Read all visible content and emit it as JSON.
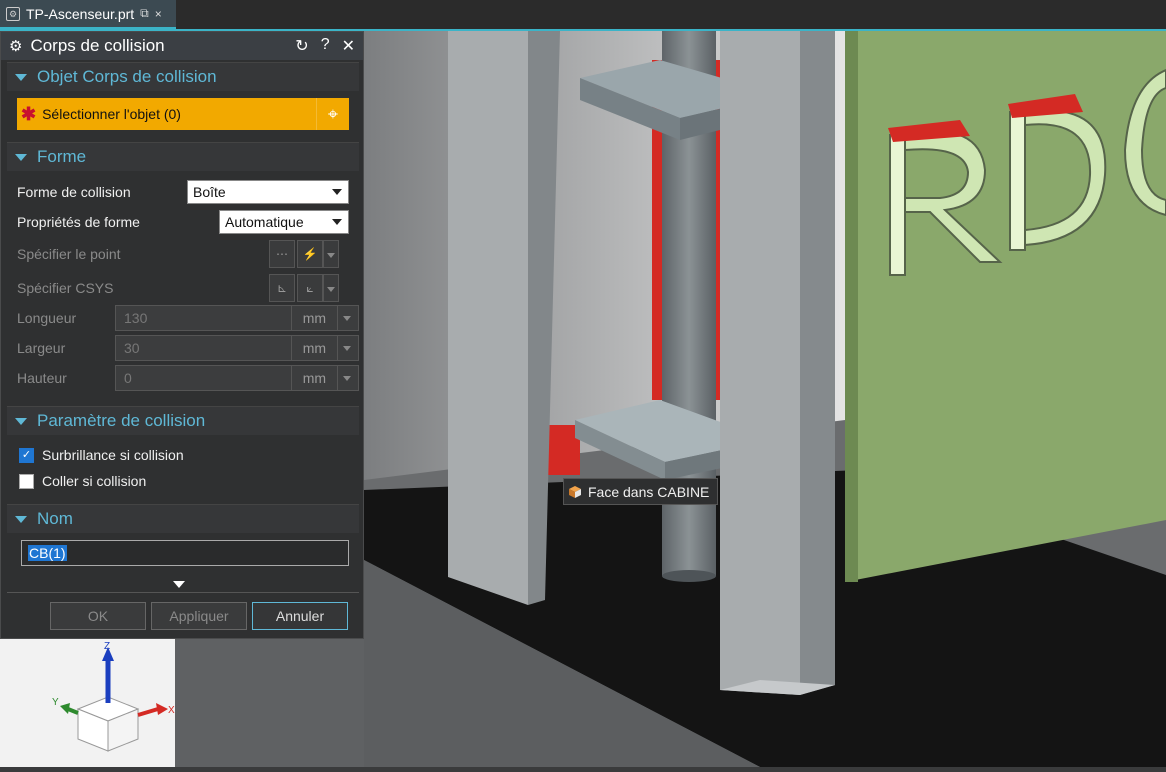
{
  "tab": {
    "title": "TP-Ascenseur.prt",
    "close": "×"
  },
  "dialog": {
    "title": "Corps de collision",
    "tools": {
      "reset": "↻",
      "help": "?",
      "close": "✕"
    },
    "sections": {
      "object": {
        "title": "Objet Corps de collision",
        "select_label": "Sélectionner l'objet (0)"
      },
      "shape": {
        "title": "Forme",
        "collision_shape_label": "Forme de collision",
        "collision_shape_value": "Boîte",
        "shape_props_label": "Propriétés de forme",
        "shape_props_value": "Automatique",
        "specify_point_label": "Spécifier le point",
        "specify_csys_label": "Spécifier CSYS",
        "length_label": "Longueur",
        "length_value": "130",
        "width_label": "Largeur",
        "width_value": "30",
        "height_label": "Hauteur",
        "height_value": "0",
        "unit": "mm"
      },
      "collision": {
        "title": "Paramètre de collision",
        "highlight_label": "Surbrillance si collision",
        "highlight_checked": true,
        "stick_label": "Coller si collision",
        "stick_checked": false
      },
      "name": {
        "title": "Nom",
        "value": "CB(1)"
      }
    },
    "buttons": {
      "ok": "OK",
      "apply": "Appliquer",
      "cancel": "Annuler"
    }
  },
  "viewport": {
    "sign_text": "RDC",
    "tooltip": "Face dans CABINE",
    "triad": {
      "z": "Z",
      "y": "Y",
      "x": "X"
    },
    "colors": {
      "panel": "#8aa86b",
      "post": "#a8acae",
      "red": "#d42a24",
      "floor": "#141414"
    }
  }
}
